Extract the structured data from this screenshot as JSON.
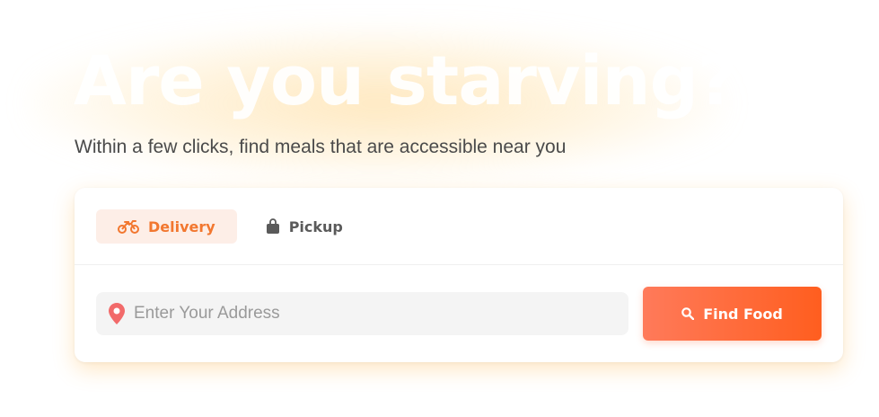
{
  "hero": {
    "title": "Are you starving?",
    "subtitle": "Within a few clicks, find meals that are accessible near you"
  },
  "tabs": [
    {
      "label": "Delivery",
      "icon": "motorbike-icon",
      "active": true
    },
    {
      "label": "Pickup",
      "icon": "shopping-bag-icon",
      "active": false
    }
  ],
  "search": {
    "value": "",
    "placeholder": "Enter Your Address",
    "icon": "location-pin-icon"
  },
  "find_button": {
    "label": "Find Food",
    "icon": "search-icon"
  },
  "colors": {
    "accent": "#f2772f",
    "active_tab_bg": "#fdeee7",
    "pin": "#f26a6a",
    "button_gradient_start": "#ff7a5a",
    "button_gradient_end": "#ff5e1f",
    "subtitle_text": "#4a4a4a"
  }
}
